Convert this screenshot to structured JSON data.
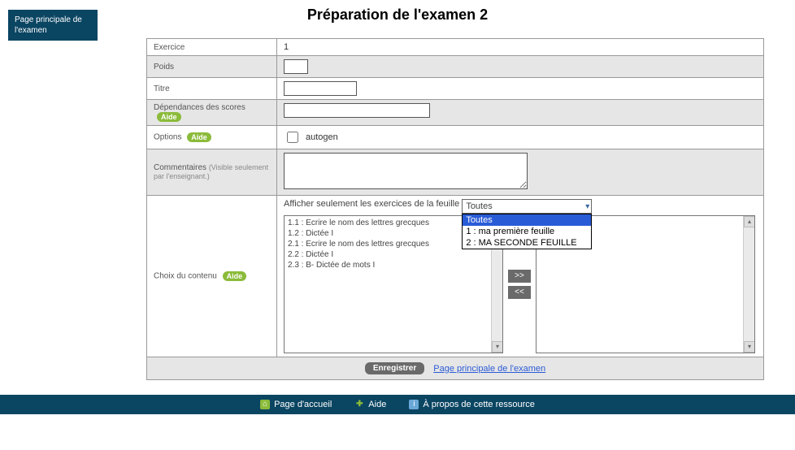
{
  "nav": {
    "main_page_label": "Page principale de l'examen"
  },
  "title": "Préparation de l'examen 2",
  "rows": {
    "exercice": {
      "label": "Exercice",
      "value": "1"
    },
    "poids": {
      "label": "Poids",
      "value": ""
    },
    "titre": {
      "label": "Titre",
      "value": ""
    },
    "deps": {
      "label": "Dépendances des scores",
      "help": "Aide",
      "value": ""
    },
    "options": {
      "label": "Options",
      "help": "Aide",
      "autogen_label": "autogen",
      "autogen_checked": false
    },
    "comments": {
      "label": "Commentaires",
      "sub": "(Visible seulement par l'enseignant.)",
      "value": ""
    },
    "content": {
      "label": "Choix du contenu",
      "help": "Aide"
    }
  },
  "filter": {
    "label": "Afficher seulement les exercices de la feuille",
    "selected": "Toutes",
    "options": [
      "Toutes",
      "1 : ma première feuille",
      "2 : MA SECONDE FEUILLE"
    ]
  },
  "available_items": [
    "1.1 : Ecrire le nom des lettres grecques",
    "1.2 : Dictée I",
    "2.1 : Ecrire le nom des lettres grecques",
    "2.2 : Dictée I",
    "2.3 : B- Dictée de mots I"
  ],
  "buttons": {
    "move_right": ">>",
    "move_left": "<<",
    "save": "Enregistrer",
    "back_link": "Page principale de l'examen"
  },
  "footer": {
    "home": "Page d'accueil",
    "help": "Aide",
    "about": "À propos de cette ressource"
  }
}
